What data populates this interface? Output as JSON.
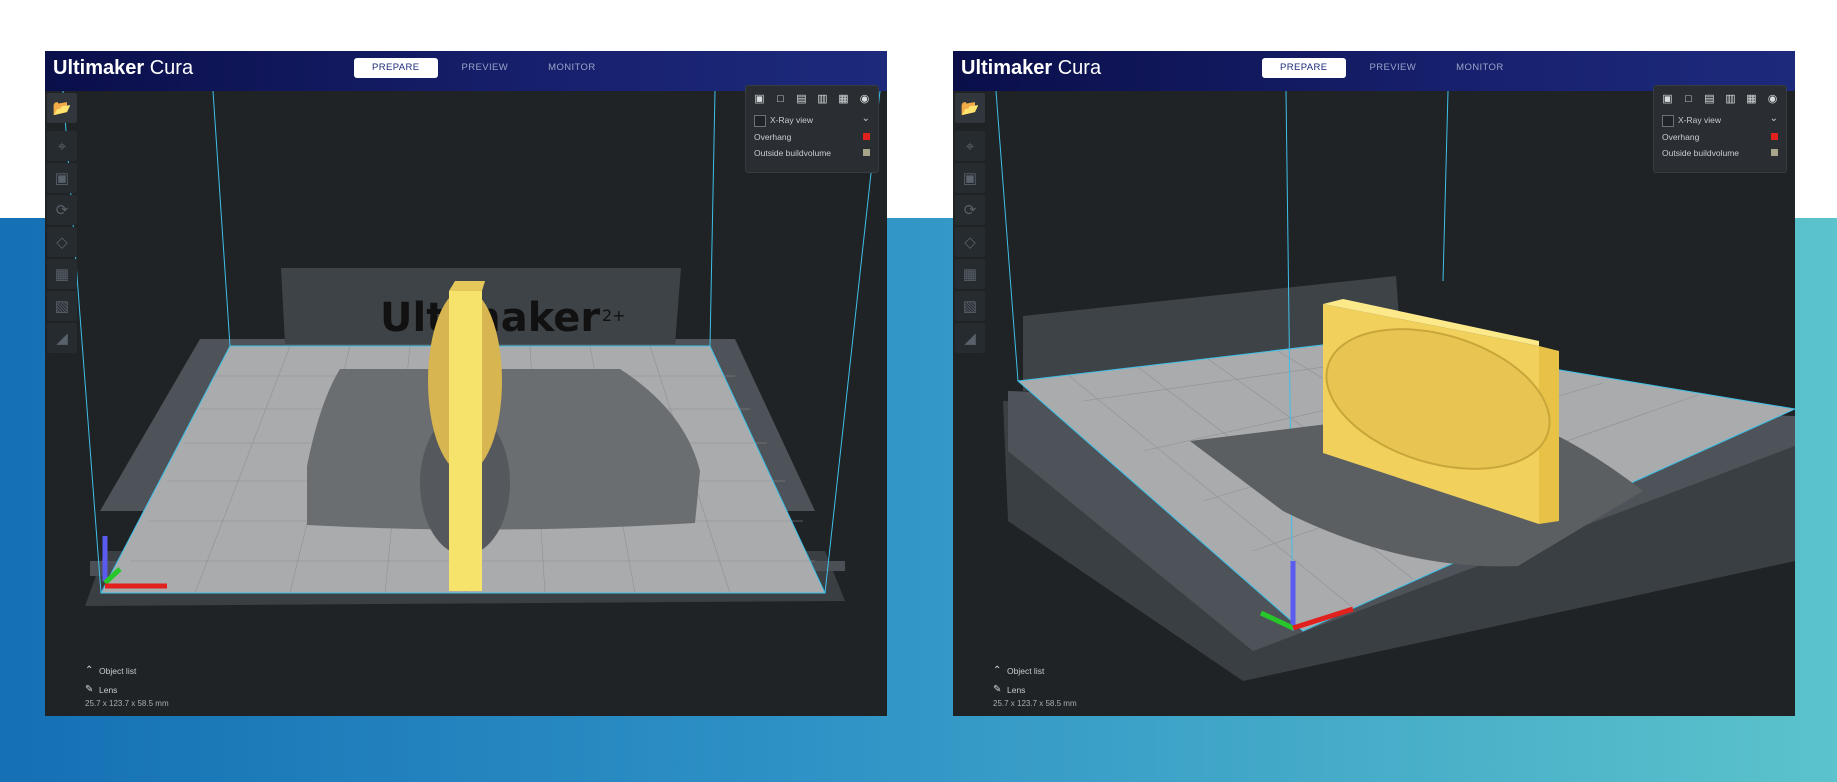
{
  "app": {
    "brand_bold": "Ultimaker",
    "brand_light": "Cura"
  },
  "tabs": [
    "PREPARE",
    "PREVIEW",
    "MONITOR"
  ],
  "view_panel": {
    "icons": [
      "view-3d-icon",
      "view-front-icon",
      "view-top-icon",
      "view-left-icon",
      "view-right-icon",
      "view-eye-icon"
    ],
    "xray_label": "X-Ray view",
    "overhang_label": "Overhang",
    "outside_label": "Outside buildvolume",
    "overhang_color": "#e0211d",
    "outside_color": "#a7a58a"
  },
  "toolbar": {
    "icons": [
      "open-folder-icon",
      "move-icon",
      "scale-icon",
      "rotate-icon",
      "mirror-icon",
      "per-model-settings-icon",
      "support-blocker-icon",
      "layer-view-icon"
    ]
  },
  "bottom": {
    "object_list_label": "Object list",
    "object_name": "Lens",
    "dimensions": "25.7 x 123.7 x 58.5 mm"
  },
  "scene": {
    "printer_logo_text": "Ultimaker",
    "printer_logo_suffix": "2+",
    "model_color": "#f2d66a",
    "axis_colors": {
      "x": "#e0211d",
      "y": "#27c62a",
      "z": "#5b5bf0"
    },
    "buildvolume_color": "#3ec0e8"
  }
}
